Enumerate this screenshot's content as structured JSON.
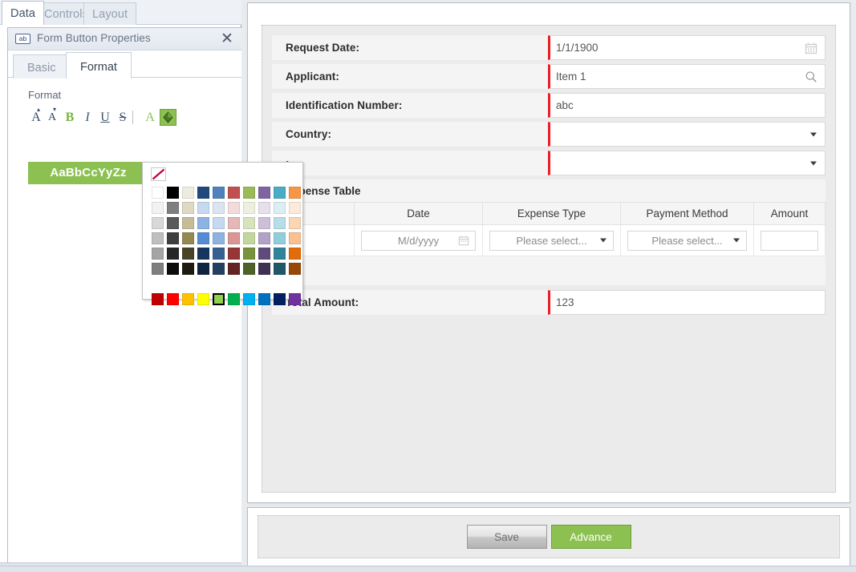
{
  "left_panel": {
    "top_tabs": [
      {
        "id": "data",
        "label": "Data",
        "active": true
      },
      {
        "id": "controls",
        "label": "Controls",
        "active": false
      },
      {
        "id": "layout",
        "label": "Layout",
        "active": false
      }
    ],
    "dialog": {
      "icon": "ab",
      "icon_name": "textbox-ab-icon",
      "title": "Form Button Properties",
      "close_label": "✕",
      "sub_tabs": [
        {
          "id": "basic",
          "label": "Basic",
          "active": false
        },
        {
          "id": "format",
          "label": "Format",
          "active": true
        }
      ],
      "format": {
        "section_label": "Format",
        "toolbar": [
          {
            "id": "grow-font",
            "glyph": "A",
            "title": "Grow Font"
          },
          {
            "id": "shrink-font",
            "glyph": "A",
            "title": "Shrink Font"
          },
          {
            "id": "bold",
            "glyph": "B",
            "title": "Bold",
            "active": true
          },
          {
            "id": "italic",
            "glyph": "I",
            "title": "Italic"
          },
          {
            "id": "underline",
            "glyph": "U",
            "title": "Underline"
          },
          {
            "id": "strikethrough",
            "glyph": "S",
            "title": "Strikethrough"
          },
          {
            "id": "font-color",
            "glyph": "A",
            "title": "Font Color"
          },
          {
            "id": "fill-color",
            "glyph": "",
            "title": "Fill Color",
            "active": true
          }
        ],
        "sample_text": "AaBbCcYyZz",
        "sample_fill": "#8cc152",
        "sample_color": "#ffffff",
        "accent_color": "#8cc152"
      }
    }
  },
  "color_picker": {
    "no_color_label": "No Color",
    "selected_color": "#92d050",
    "selected_index": 64,
    "swatches": [
      "#ffffff",
      "#000000",
      "#eeece1",
      "#1f497d",
      "#4f81bd",
      "#c0504d",
      "#9bbb59",
      "#8064a2",
      "#4bacc6",
      "#f79646",
      "#f2f2f2",
      "#7f7f7f",
      "#ddd9c3",
      "#c6d9f0",
      "#dbe5f1",
      "#f2dcdb",
      "#ebf1dd",
      "#e5e0ec",
      "#dbeef3",
      "#fdeada",
      "#d8d8d8",
      "#595959",
      "#c4bd97",
      "#8db3e2",
      "#c5d9f1",
      "#e5b8b7",
      "#d7e3bc",
      "#ccc0d9",
      "#b7dde8",
      "#fbd5b5",
      "#bfbfbf",
      "#3f3f3f",
      "#938953",
      "#548dd4",
      "#8db3e2",
      "#d99694",
      "#c3d69b",
      "#b2a2c7",
      "#92cddc",
      "#fac08f",
      "#a5a5a5",
      "#262626",
      "#494429",
      "#17365d",
      "#376092",
      "#953734",
      "#77933c",
      "#604a7b",
      "#31849b",
      "#e36c09",
      "#7f7f7f",
      "#0c0c0c",
      "#1d1b10",
      "#0f243e",
      "#244061",
      "#632423",
      "#4f6228",
      "#3f3151",
      "#205867",
      "#974806",
      "#c00000",
      "#ff0000",
      "#ffc000",
      "#ffff00",
      "#92d050",
      "#00b050",
      "#00b0f0",
      "#0070c0",
      "#002060",
      "#7030a0"
    ]
  },
  "form": {
    "rows": [
      {
        "id": "request-date",
        "label": "Request Date:",
        "value": "1/1/1900",
        "type": "date",
        "icon": "calendar-icon",
        "required": true
      },
      {
        "id": "applicant",
        "label": "Applicant:",
        "value": "Item 1",
        "type": "lookup",
        "icon": "search-icon",
        "required": true
      },
      {
        "id": "identification-number",
        "label": "Identification Number:",
        "value": "abc",
        "type": "text",
        "icon": "",
        "required": true
      },
      {
        "id": "country",
        "label": "Country:",
        "value": "",
        "type": "select",
        "icon": "chevron-down-icon",
        "required": true
      },
      {
        "id": "city",
        "label": ":",
        "value": "",
        "type": "select",
        "icon": "chevron-down-icon",
        "required": true
      }
    ],
    "table": {
      "title": "Expense Table",
      "columns": [
        "",
        "Date",
        "Expense Type",
        "Payment Method",
        "Amount"
      ],
      "rows": [
        {
          "date_placeholder": "M/d/yyyy",
          "expense_type": "Please select...",
          "payment_method": "Please select...",
          "amount": ""
        }
      ]
    },
    "total": {
      "label": "Total Amount:",
      "value": "123"
    }
  },
  "actions": {
    "save_label": "Save",
    "advance_label": "Advance",
    "advance_color": "#8cc152"
  }
}
